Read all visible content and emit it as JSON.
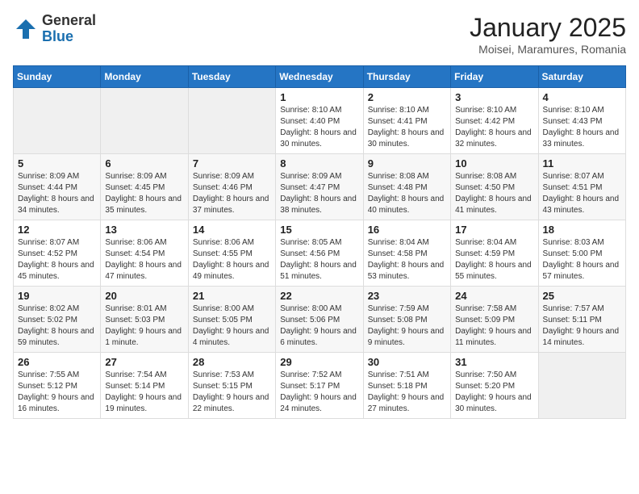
{
  "logo": {
    "general": "General",
    "blue": "Blue"
  },
  "title": {
    "month": "January 2025",
    "location": "Moisei, Maramures, Romania"
  },
  "weekdays": [
    "Sunday",
    "Monday",
    "Tuesday",
    "Wednesday",
    "Thursday",
    "Friday",
    "Saturday"
  ],
  "weeks": [
    [
      {
        "day": "",
        "sunrise": "",
        "sunset": "",
        "daylight": ""
      },
      {
        "day": "",
        "sunrise": "",
        "sunset": "",
        "daylight": ""
      },
      {
        "day": "",
        "sunrise": "",
        "sunset": "",
        "daylight": ""
      },
      {
        "day": "1",
        "sunrise": "Sunrise: 8:10 AM",
        "sunset": "Sunset: 4:40 PM",
        "daylight": "Daylight: 8 hours and 30 minutes."
      },
      {
        "day": "2",
        "sunrise": "Sunrise: 8:10 AM",
        "sunset": "Sunset: 4:41 PM",
        "daylight": "Daylight: 8 hours and 30 minutes."
      },
      {
        "day": "3",
        "sunrise": "Sunrise: 8:10 AM",
        "sunset": "Sunset: 4:42 PM",
        "daylight": "Daylight: 8 hours and 32 minutes."
      },
      {
        "day": "4",
        "sunrise": "Sunrise: 8:10 AM",
        "sunset": "Sunset: 4:43 PM",
        "daylight": "Daylight: 8 hours and 33 minutes."
      }
    ],
    [
      {
        "day": "5",
        "sunrise": "Sunrise: 8:09 AM",
        "sunset": "Sunset: 4:44 PM",
        "daylight": "Daylight: 8 hours and 34 minutes."
      },
      {
        "day": "6",
        "sunrise": "Sunrise: 8:09 AM",
        "sunset": "Sunset: 4:45 PM",
        "daylight": "Daylight: 8 hours and 35 minutes."
      },
      {
        "day": "7",
        "sunrise": "Sunrise: 8:09 AM",
        "sunset": "Sunset: 4:46 PM",
        "daylight": "Daylight: 8 hours and 37 minutes."
      },
      {
        "day": "8",
        "sunrise": "Sunrise: 8:09 AM",
        "sunset": "Sunset: 4:47 PM",
        "daylight": "Daylight: 8 hours and 38 minutes."
      },
      {
        "day": "9",
        "sunrise": "Sunrise: 8:08 AM",
        "sunset": "Sunset: 4:48 PM",
        "daylight": "Daylight: 8 hours and 40 minutes."
      },
      {
        "day": "10",
        "sunrise": "Sunrise: 8:08 AM",
        "sunset": "Sunset: 4:50 PM",
        "daylight": "Daylight: 8 hours and 41 minutes."
      },
      {
        "day": "11",
        "sunrise": "Sunrise: 8:07 AM",
        "sunset": "Sunset: 4:51 PM",
        "daylight": "Daylight: 8 hours and 43 minutes."
      }
    ],
    [
      {
        "day": "12",
        "sunrise": "Sunrise: 8:07 AM",
        "sunset": "Sunset: 4:52 PM",
        "daylight": "Daylight: 8 hours and 45 minutes."
      },
      {
        "day": "13",
        "sunrise": "Sunrise: 8:06 AM",
        "sunset": "Sunset: 4:54 PM",
        "daylight": "Daylight: 8 hours and 47 minutes."
      },
      {
        "day": "14",
        "sunrise": "Sunrise: 8:06 AM",
        "sunset": "Sunset: 4:55 PM",
        "daylight": "Daylight: 8 hours and 49 minutes."
      },
      {
        "day": "15",
        "sunrise": "Sunrise: 8:05 AM",
        "sunset": "Sunset: 4:56 PM",
        "daylight": "Daylight: 8 hours and 51 minutes."
      },
      {
        "day": "16",
        "sunrise": "Sunrise: 8:04 AM",
        "sunset": "Sunset: 4:58 PM",
        "daylight": "Daylight: 8 hours and 53 minutes."
      },
      {
        "day": "17",
        "sunrise": "Sunrise: 8:04 AM",
        "sunset": "Sunset: 4:59 PM",
        "daylight": "Daylight: 8 hours and 55 minutes."
      },
      {
        "day": "18",
        "sunrise": "Sunrise: 8:03 AM",
        "sunset": "Sunset: 5:00 PM",
        "daylight": "Daylight: 8 hours and 57 minutes."
      }
    ],
    [
      {
        "day": "19",
        "sunrise": "Sunrise: 8:02 AM",
        "sunset": "Sunset: 5:02 PM",
        "daylight": "Daylight: 8 hours and 59 minutes."
      },
      {
        "day": "20",
        "sunrise": "Sunrise: 8:01 AM",
        "sunset": "Sunset: 5:03 PM",
        "daylight": "Daylight: 9 hours and 1 minute."
      },
      {
        "day": "21",
        "sunrise": "Sunrise: 8:00 AM",
        "sunset": "Sunset: 5:05 PM",
        "daylight": "Daylight: 9 hours and 4 minutes."
      },
      {
        "day": "22",
        "sunrise": "Sunrise: 8:00 AM",
        "sunset": "Sunset: 5:06 PM",
        "daylight": "Daylight: 9 hours and 6 minutes."
      },
      {
        "day": "23",
        "sunrise": "Sunrise: 7:59 AM",
        "sunset": "Sunset: 5:08 PM",
        "daylight": "Daylight: 9 hours and 9 minutes."
      },
      {
        "day": "24",
        "sunrise": "Sunrise: 7:58 AM",
        "sunset": "Sunset: 5:09 PM",
        "daylight": "Daylight: 9 hours and 11 minutes."
      },
      {
        "day": "25",
        "sunrise": "Sunrise: 7:57 AM",
        "sunset": "Sunset: 5:11 PM",
        "daylight": "Daylight: 9 hours and 14 minutes."
      }
    ],
    [
      {
        "day": "26",
        "sunrise": "Sunrise: 7:55 AM",
        "sunset": "Sunset: 5:12 PM",
        "daylight": "Daylight: 9 hours and 16 minutes."
      },
      {
        "day": "27",
        "sunrise": "Sunrise: 7:54 AM",
        "sunset": "Sunset: 5:14 PM",
        "daylight": "Daylight: 9 hours and 19 minutes."
      },
      {
        "day": "28",
        "sunrise": "Sunrise: 7:53 AM",
        "sunset": "Sunset: 5:15 PM",
        "daylight": "Daylight: 9 hours and 22 minutes."
      },
      {
        "day": "29",
        "sunrise": "Sunrise: 7:52 AM",
        "sunset": "Sunset: 5:17 PM",
        "daylight": "Daylight: 9 hours and 24 minutes."
      },
      {
        "day": "30",
        "sunrise": "Sunrise: 7:51 AM",
        "sunset": "Sunset: 5:18 PM",
        "daylight": "Daylight: 9 hours and 27 minutes."
      },
      {
        "day": "31",
        "sunrise": "Sunrise: 7:50 AM",
        "sunset": "Sunset: 5:20 PM",
        "daylight": "Daylight: 9 hours and 30 minutes."
      },
      {
        "day": "",
        "sunrise": "",
        "sunset": "",
        "daylight": ""
      }
    ]
  ]
}
